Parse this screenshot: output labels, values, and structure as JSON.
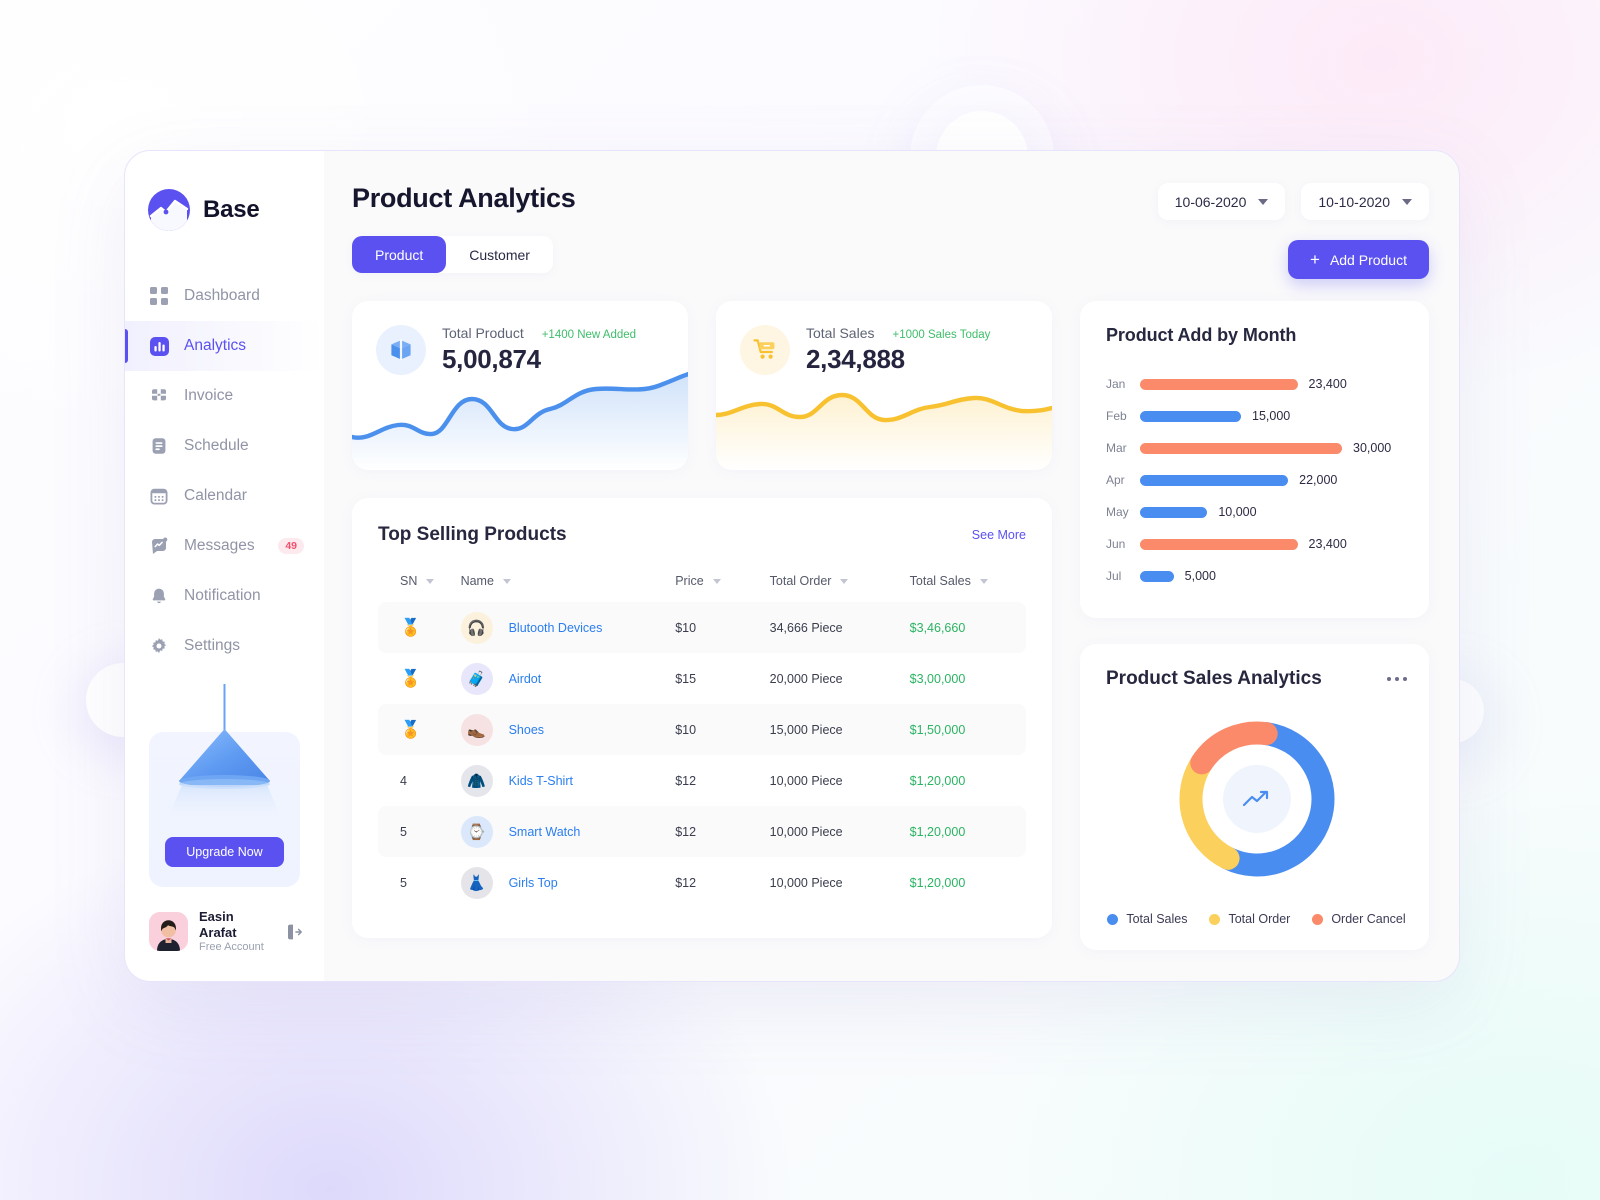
{
  "brand": {
    "name": "Base",
    "logo_icon": "chart-line-logo-icon"
  },
  "sidebar": {
    "items": [
      {
        "label": "Dashboard",
        "icon": "grid-icon",
        "active": false
      },
      {
        "label": "Analytics",
        "icon": "bar-chart-icon",
        "active": true
      },
      {
        "label": "Invoice",
        "icon": "invoice-icon",
        "active": false
      },
      {
        "label": "Schedule",
        "icon": "clipboard-icon",
        "active": false
      },
      {
        "label": "Calendar",
        "icon": "calendar-icon",
        "active": false
      },
      {
        "label": "Messages",
        "icon": "message-chart-icon",
        "active": false,
        "badge": "49"
      },
      {
        "label": "Notification",
        "icon": "bell-icon",
        "active": false
      },
      {
        "label": "Settings",
        "icon": "gear-icon",
        "active": false
      }
    ],
    "upgrade_label": "Upgrade Now",
    "user": {
      "name": "Easin Arafat",
      "plan": "Free Account",
      "logout_icon": "logout-icon"
    }
  },
  "header": {
    "title": "Product Analytics",
    "tabs": [
      {
        "label": "Product",
        "active": true
      },
      {
        "label": "Customer",
        "active": false
      }
    ],
    "date_from": "10-06-2020",
    "date_to": "10-10-2020",
    "add_product_label": "Add Product",
    "add_product_icon": "plus-icon"
  },
  "stats": [
    {
      "label": "Total Product",
      "value": "5,00,874",
      "delta": "+1400 New Added",
      "icon": "box-icon",
      "color": "#4a90ec"
    },
    {
      "label": "Total Sales",
      "value": "2,34,888",
      "delta": "+1000 Sales Today",
      "icon": "cart-icon",
      "color": "#f7c12f"
    }
  ],
  "table": {
    "title": "Top Selling Products",
    "see_more": "See More",
    "columns": [
      "SN",
      "Name",
      "Price",
      "Total Order",
      "Total Sales"
    ],
    "rows": [
      {
        "sn": "medal",
        "icon": "headphones-icon",
        "icon_bg": "#fbf1dd",
        "glyph": "🎧",
        "name": "Blutooth Devices",
        "price": "$10",
        "order": "34,666 Piece",
        "sales": "$3,46,660"
      },
      {
        "sn": "medal",
        "icon": "airpods-case-icon",
        "icon_bg": "#e8e6fb",
        "glyph": "🧳",
        "name": "Airdot",
        "price": "$15",
        "order": "20,000 Piece",
        "sales": "$3,00,000"
      },
      {
        "sn": "medal",
        "icon": "shoe-icon",
        "icon_bg": "#f6e2e3",
        "glyph": "👞",
        "name": "Shoes",
        "price": "$10",
        "order": "15,000 Piece",
        "sales": "$1,50,000"
      },
      {
        "sn": "4",
        "icon": "tshirt-icon",
        "icon_bg": "#e5e5ec",
        "glyph": "🧥",
        "name": "Kids T-Shirt",
        "price": "$12",
        "order": "10,000 Piece",
        "sales": "$1,20,000"
      },
      {
        "sn": "5",
        "icon": "smartwatch-icon",
        "icon_bg": "#dbe8fb",
        "glyph": "⌚",
        "name": "Smart Watch",
        "price": "$12",
        "order": "10,000 Piece",
        "sales": "$1,20,000"
      },
      {
        "sn": "5",
        "icon": "dress-icon",
        "icon_bg": "#e4e4e9",
        "glyph": "👗",
        "name": "Girls Top",
        "price": "$12",
        "order": "10,000 Piece",
        "sales": "$1,20,000"
      }
    ]
  },
  "donut_card": {
    "title": "Product Sales Analytics",
    "menu_icon": "more-horizontal-icon",
    "center_icon": "trend-up-icon"
  },
  "chart_data": [
    {
      "type": "bar",
      "orientation": "horizontal",
      "title": "Product Add  by Month",
      "categories": [
        "Jan",
        "Feb",
        "Mar",
        "Apr",
        "May",
        "Jun",
        "Jul"
      ],
      "values": [
        23400,
        15000,
        30000,
        22000,
        10000,
        23400,
        5000
      ],
      "labels": [
        "23,400",
        "15,000",
        "30,000",
        "22,000",
        "10,000",
        "23,400",
        "5,000"
      ],
      "colors": [
        "#fa8a6a",
        "#4a8df0",
        "#fa8a6a",
        "#4a8df0",
        "#4a8df0",
        "#fa8a6a",
        "#4a8df0"
      ],
      "xlabel": "",
      "ylabel": "",
      "xlim": [
        0,
        30000
      ],
      "grid": false,
      "legend": "none"
    },
    {
      "type": "pie",
      "variant": "donut",
      "title": "Product Sales Analytics",
      "categories": [
        "Total Sales",
        "Total Order",
        "Order Cancel"
      ],
      "values": [
        55,
        27,
        18
      ],
      "colors": [
        "#4a8df0",
        "#fbd05c",
        "#fa8a6a"
      ],
      "legend": "bottom",
      "start_angle": 8
    }
  ]
}
